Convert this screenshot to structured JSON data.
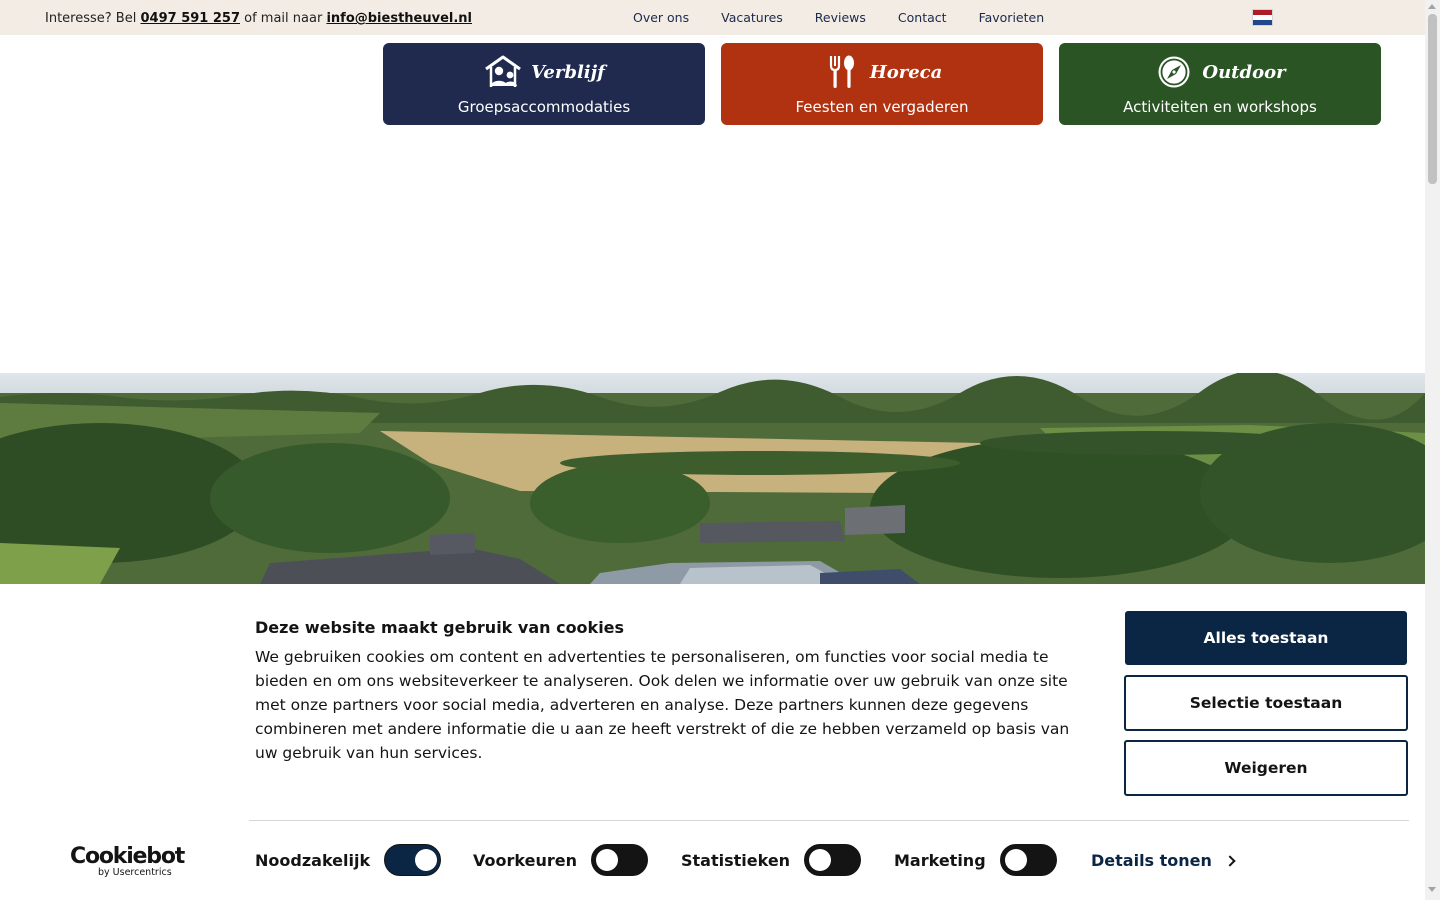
{
  "topbar": {
    "interest_text": "Interesse? Bel",
    "phone": "0497 591 257",
    "mail_text": "of mail naar",
    "email": "info@biestheuvel.nl",
    "nav": [
      {
        "label": "Over ons"
      },
      {
        "label": "Vacatures"
      },
      {
        "label": "Reviews"
      },
      {
        "label": "Contact"
      },
      {
        "label": "Favorieten"
      }
    ],
    "flag_icon": "netherlands-flag-icon",
    "flag_colors": [
      "#ae1c28",
      "#ffffff",
      "#21468b"
    ]
  },
  "tiles": [
    {
      "title": "Verblijf",
      "subtitle": "Groepsaccommodaties",
      "icon": "house-people-icon",
      "color": "#1f2a4e"
    },
    {
      "title": "Horeca",
      "subtitle": "Feesten en vergaderen",
      "icon": "fork-spoon-icon",
      "color": "#b03211"
    },
    {
      "title": "Outdoor",
      "subtitle": "Activiteiten en workshops",
      "icon": "compass-icon",
      "color": "#2b5425"
    }
  ],
  "cookie": {
    "title": "Deze website maakt gebruik van cookies",
    "text": "We gebruiken cookies om content en advertenties te personaliseren, om functies voor social media te bieden en om ons websiteverkeer te analyseren. Ook delen we informatie over uw gebruik van onze site met onze partners voor social media, adverteren en analyse. Deze partners kunnen deze gegevens combineren met andere informatie die u aan ze heeft verstrekt of die ze hebben verzameld op basis van uw gebruik van hun services.",
    "buttons": {
      "allow_all": "Alles toestaan",
      "allow_selection": "Selectie toestaan",
      "deny": "Weigeren"
    },
    "toggles": [
      {
        "label": "Noodzakelijk",
        "on": true
      },
      {
        "label": "Voorkeuren",
        "on": false
      },
      {
        "label": "Statistieken",
        "on": false
      },
      {
        "label": "Marketing",
        "on": false
      }
    ],
    "details_link": "Details tonen",
    "logo": {
      "name": "Cookiebot",
      "byline": "by Usercentrics"
    },
    "accent_color": "#0b2544"
  }
}
